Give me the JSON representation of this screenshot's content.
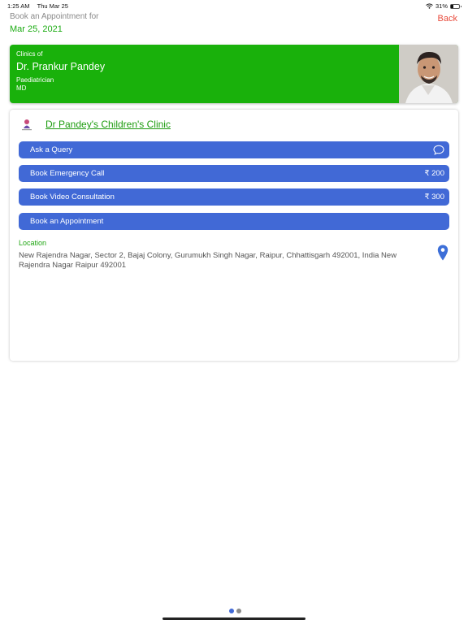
{
  "status_bar": {
    "time": "1:25 AM",
    "date": "Thu Mar 25",
    "battery": "31%",
    "battery_level": 0.31
  },
  "header": {
    "subtitle": "Book an Appointment for",
    "date": "Mar 25, 2021",
    "back_label": "Back"
  },
  "doctor": {
    "clinics_of": "Clinics of",
    "name": "Dr. Prankur Pandey",
    "specialty": "Paediatrician",
    "degree": "MD"
  },
  "clinic": {
    "name": "Dr Pandey's Children's Clinic",
    "actions": [
      {
        "label": "Ask a Query",
        "icon": "chat-bubble-icon"
      },
      {
        "label": "Book Emergency Call",
        "price": "₹ 200"
      },
      {
        "label": "Book Video Consultation",
        "price": "₹ 300"
      },
      {
        "label": "Book an Appointment"
      }
    ],
    "location_label": "Location",
    "address": "New Rajendra Nagar, Sector 2, Bajaj Colony, Gurumukh Singh Nagar, Raipur, Chhattisgarh 492001, India New Rajendra Nagar Raipur 492001",
    "location_icon": "map-pin-icon"
  },
  "pager": {
    "pages": 2,
    "current": 1
  },
  "colors": {
    "accent_green": "#19b10b",
    "button_blue": "#4169d6",
    "back_red": "#e84b3c",
    "dot_active": "#4169d6",
    "dot_inactive": "#8a8a8a"
  }
}
